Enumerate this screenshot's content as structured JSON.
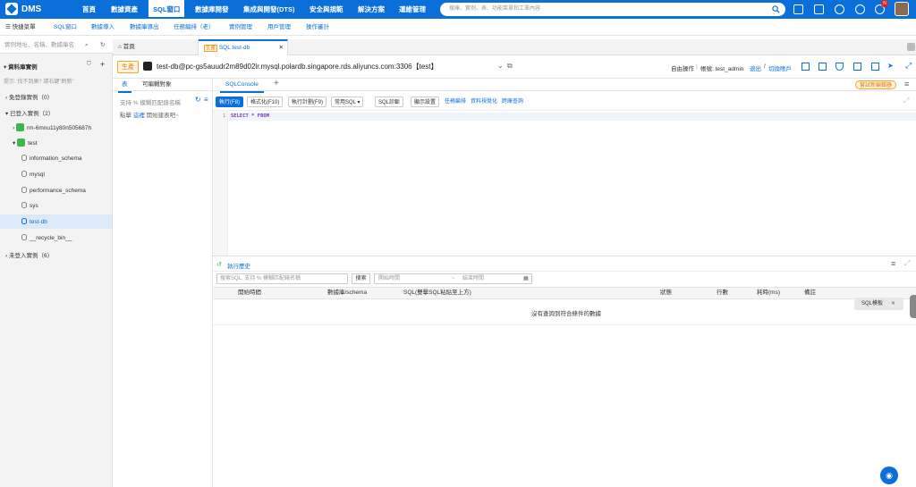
{
  "topbar": {
    "logo_text": "DMS",
    "nav": [
      "首頁",
      "數據資產",
      "SQL窗口",
      "數據庫開發",
      "集成與開發(DTS)",
      "安全與規範",
      "解決方案",
      "運維管理"
    ],
    "search_placeholder": "搜庫、實例、表、功能菜單和工單內容",
    "notification_badge": "N"
  },
  "quickbar": {
    "menu_label": "快捷菜單",
    "links": [
      "SQL窗口",
      "數據導入",
      "數據庫導出",
      "任務編排（老）",
      "實例管理",
      "用戶管理",
      "操作審計"
    ]
  },
  "left": {
    "search_placeholder": "實例地址、名稱、數據庫名",
    "section_title": "資料庫實例",
    "hint": "提示: 找不到庫? 請右鍵\"刷新\"",
    "groups": {
      "unlogged_top": "免登錄實例（0）",
      "logged": "已登入實例（2）",
      "unlogged_bottom": "未登入實例（6）"
    },
    "instance_rm": "rm-6mnu11y80n505687h",
    "instance_test": "test",
    "databases": [
      "information_schema",
      "mysql",
      "performance_schema",
      "sys",
      "test-db",
      "__recycle_bin__"
    ]
  },
  "tabs": {
    "home": "首頁",
    "sql_tag": "生產",
    "sql_tab": "SQL test-db"
  },
  "connection": {
    "env": "生產",
    "title": "test-db@pc-gs5auudr2m89d02lr.mysql.polardb.singapore.rds.aliyuncs.com:3306【test】",
    "mode": "自由操作",
    "account_label": "帳號: test_admin",
    "logout": "退出",
    "switch_account": "切換賬戶"
  },
  "midpanel": {
    "tab_tables": "表",
    "tab_editable": "可編輯對象",
    "hint_line1": "支持 % 模糊匹配錶名稱",
    "hint_prefix": "點擊",
    "hint_link": "這裡",
    "hint_suffix": "開始建表吧~"
  },
  "console": {
    "tab": "SQLConsole",
    "try_new_editor": "嘗試新編輯器",
    "toolbar": [
      "執行(F8)",
      "格式化(F10)",
      "執行計劃(F9)",
      "常用SQL ▾",
      "SQL診斷",
      "顯示設置"
    ],
    "links": [
      "任務編排",
      "資料視覺化",
      "跨庫查詢"
    ],
    "line_number": "1",
    "sql": "SELECT * FROM"
  },
  "history": {
    "title": "執行歷史",
    "search_placeholder": "搜索SQL, 支持 % 模糊匹配錶名稱",
    "search_button": "搜索",
    "start_time_placeholder": "開始時間",
    "end_time_placeholder": "結束時間",
    "columns": [
      "開始時間",
      "數據庫/schema",
      "SQL(雙擊SQL粘貼至上方)",
      "狀態",
      "行數",
      "耗時(ms)",
      "備註"
    ],
    "empty_text": "沒有查詢到符合條件的數據",
    "sql_template_label": "SQL模板"
  }
}
